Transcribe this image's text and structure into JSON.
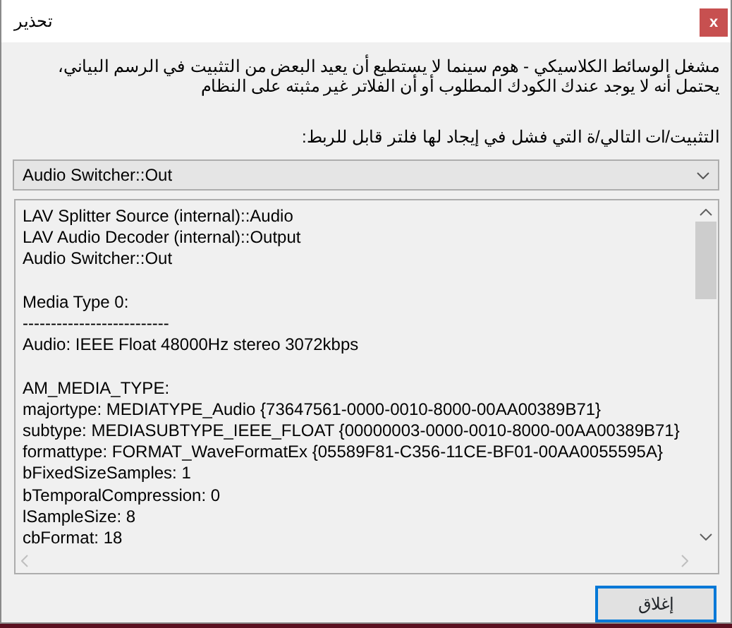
{
  "window": {
    "title": "تحذير",
    "close_label": "x"
  },
  "message": "مشغل الوسائط الكلاسيكي - هوم سينما لا يستطيع أن يعيد البعض من التثبيت في الرسم البياني، يحتمل أنه لا يوجد عندك الكودك المطلوب أو أن الفلاتر غير مثبته على النظام",
  "pins_label": "التثبيت/ات التالي/ة التي فشل في إيجاد لها فلتر قابل للربط:",
  "pin_dropdown": {
    "value": "Audio Switcher::Out"
  },
  "details": [
    [
      "LAV Splitter Source (internal)::Audio",
      "LAV Audio Decoder (internal)::Output",
      "Audio Switcher::Out"
    ],
    [
      "Media Type 0:",
      "--------------------------",
      "Audio: IEEE Float 48000Hz stereo 3072kbps"
    ],
    [
      "AM_MEDIA_TYPE:",
      "majortype: MEDIATYPE_Audio {73647561-0000-0010-8000-00AA00389B71}",
      "subtype: MEDIASUBTYPE_IEEE_FLOAT {00000003-0000-0010-8000-00AA00389B71}",
      "formattype: FORMAT_WaveFormatEx {05589F81-C356-11CE-BF01-00AA0055595A}",
      "bFixedSizeSamples: 1",
      "bTemporalCompression: 0",
      "lSampleSize: 8",
      "cbFormat: 18"
    ]
  ],
  "buttons": [
    {
      "label": "إغلاق",
      "kind": "default"
    }
  ]
}
